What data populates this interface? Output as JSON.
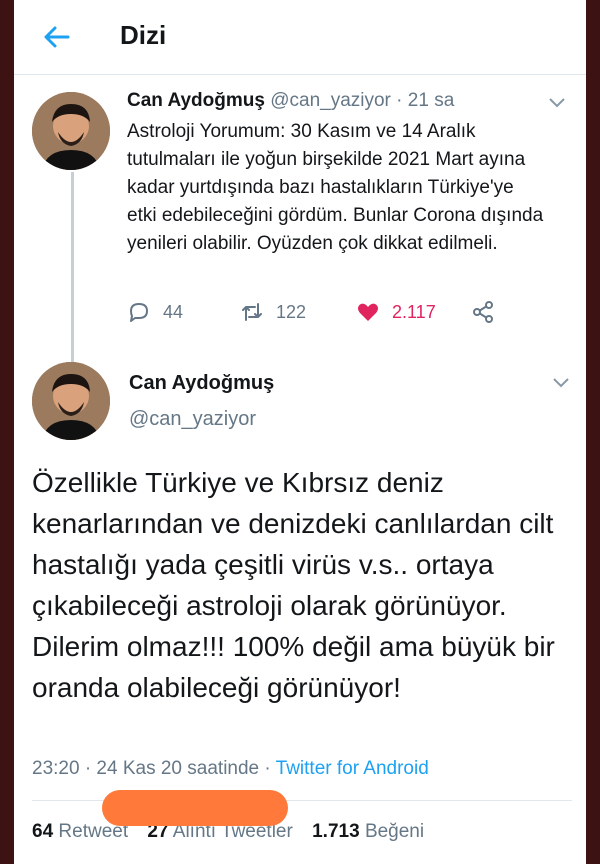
{
  "header": {
    "title": "Dizi"
  },
  "tweet1": {
    "name": "Can Aydoğmuş",
    "handle": "@can_yaziyor",
    "time": "· 21 sa",
    "text": "Astroloji Yorumum: 30 Kasım ve 14 Aralık tutulmaları ile yoğun birşekilde 2021 Mart ayına kadar yurtdışında bazı hastalıkların Türkiye'ye etki edebileceğini gördüm. Bunlar Corona dışında yenileri olabilir. Oyüzden çok dikkat edilmeli.",
    "replies": "44",
    "retweets": "122",
    "likes": "2.117"
  },
  "tweet2": {
    "name": "Can Aydoğmuş",
    "handle": "@can_yaziyor",
    "text": "Özellikle Türkiye ve Kıbrsız deniz kenarlarından ve denizdeki canlılardan cilt hastalığı yada çeşitli virüs v.s.. ortaya çıkabileceği astroloji olarak görünüyor. Dilerim olmaz!!! 100% değil ama büyük bir oranda olabileceği görünüyor!",
    "meta_time": "23:20 · 24 Kas 20 saatinde ·",
    "meta_source": "Twitter for Android",
    "retweet_count": "64",
    "retweet_label": "Retweet",
    "quote_count": "27",
    "quote_label": "Alıntı Tweetler",
    "like_count": "1.713",
    "like_label": "Beğeni"
  },
  "colors": {
    "accent": "#1da1f2",
    "like": "#e0245e",
    "muted": "#657786",
    "scribble": "#ff7a3a"
  },
  "icons": [
    "back-arrow-icon",
    "chevron-down-icon",
    "reply-icon",
    "retweet-icon",
    "heart-icon",
    "share-icon"
  ]
}
